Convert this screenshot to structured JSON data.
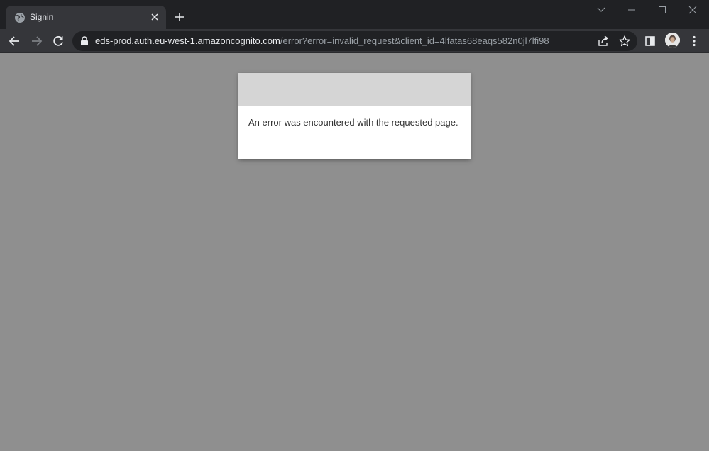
{
  "browser": {
    "tab": {
      "title": "Signin",
      "favicon": "globe-icon"
    },
    "omnibox": {
      "host": "eds-prod.auth.eu-west-1.amazoncognito.com",
      "path": "/error?error=invalid_request&client_id=4lfatas68eaqs582n0jl7lfi98"
    },
    "colors": {
      "tabstrip": "#202124",
      "toolbar": "#35363a",
      "page_background": "#8f8f8f"
    }
  },
  "page": {
    "error_message": "An error was encountered with the requested page."
  }
}
